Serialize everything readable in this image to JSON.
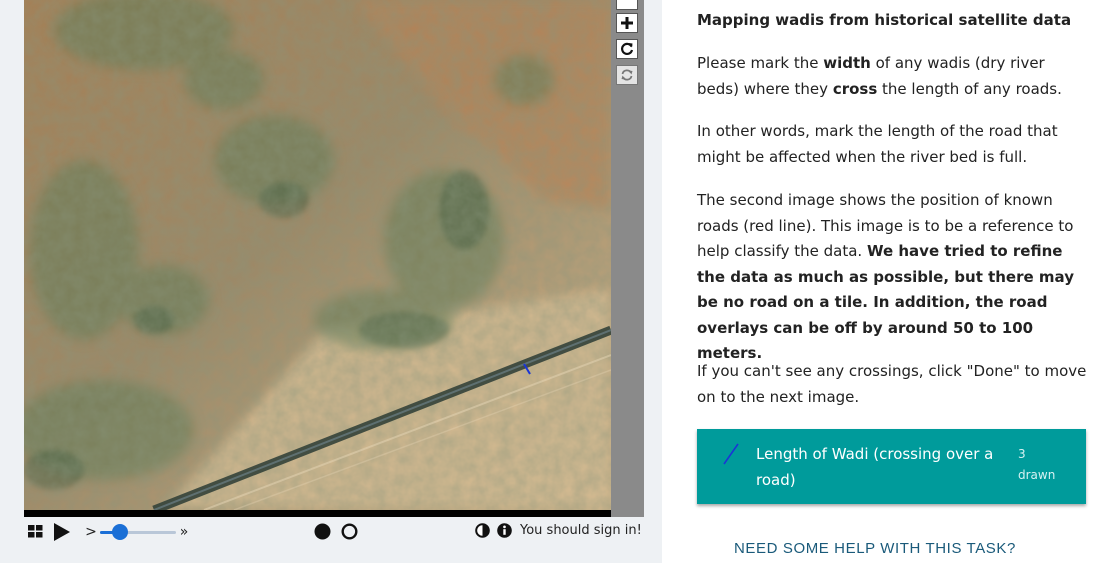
{
  "viewer": {
    "sign_in_message": "You should sign in!",
    "step_glyph": ">",
    "fast_glyph": "»",
    "speed_level": 0.2,
    "icons": {
      "zoom_in": "plus-icon",
      "reset": "reset-icon",
      "rotate": "rotate-icon",
      "frames": "grid-icon",
      "play": "play-icon",
      "contrast": "contrast-icon",
      "info": "info-icon"
    }
  },
  "task": {
    "title": "Mapping wadis from historical satellite data",
    "p1": {
      "a": "Please mark the ",
      "b": "width",
      "c": " of any wadis (dry river beds) where they ",
      "d": "cross",
      "e": " the length of any roads."
    },
    "p2": "In other words, mark the length of the road that might be affected when the river bed is full.",
    "p3": {
      "a": "The second image shows the position of known roads (red line). This image is to be a reference to help classify the data. ",
      "b": "We have tried to refine the data as much as possible, but there may be no road on a tile. In addition, the road overlays can be off by around 50 to 100 meters."
    },
    "p4": "If you can't see any crossings, click \"Done\" to move on to the next image.",
    "tool": {
      "label": "Length of Wadi (crossing over a road)",
      "count": "3",
      "count_suffix": "drawn",
      "color": "#009b9b",
      "line_color": "#1a35d6"
    }
  },
  "help_link": "NEED SOME HELP WITH THIS TASK?"
}
